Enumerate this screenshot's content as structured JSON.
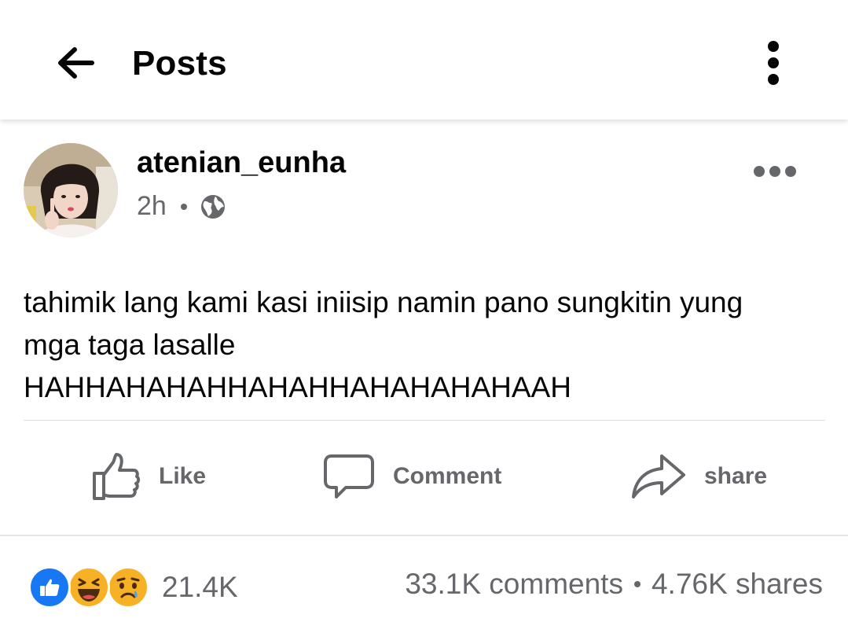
{
  "header": {
    "title": "Posts",
    "back_icon": "arrow-left-icon",
    "menu_icon": "vertical-dots-icon"
  },
  "post": {
    "author": "atenian_eunha",
    "time": "2h",
    "audience_icon": "globe-icon",
    "more_icon": "horizontal-dots-icon",
    "text_lines": [
      "tahimik lang kami kasi iniisip namin pano sungkitin yung",
      "mga taga lasalle",
      "HAHHAHAHAHHAHAHHAHAHAHAHAAH"
    ]
  },
  "actions": {
    "like": "Like",
    "comment": "Comment",
    "share": "share"
  },
  "stats": {
    "reactions": [
      "like",
      "haha",
      "sad"
    ],
    "reaction_count": "21.4K",
    "comments": "33.1K comments",
    "shares": "4.76K shares"
  },
  "colors": {
    "text_primary": "#050505",
    "text_secondary": "#65676b",
    "like_blue": "#1877f2",
    "emoji_yellow": "#f7b125",
    "divider": "#dadde1"
  }
}
